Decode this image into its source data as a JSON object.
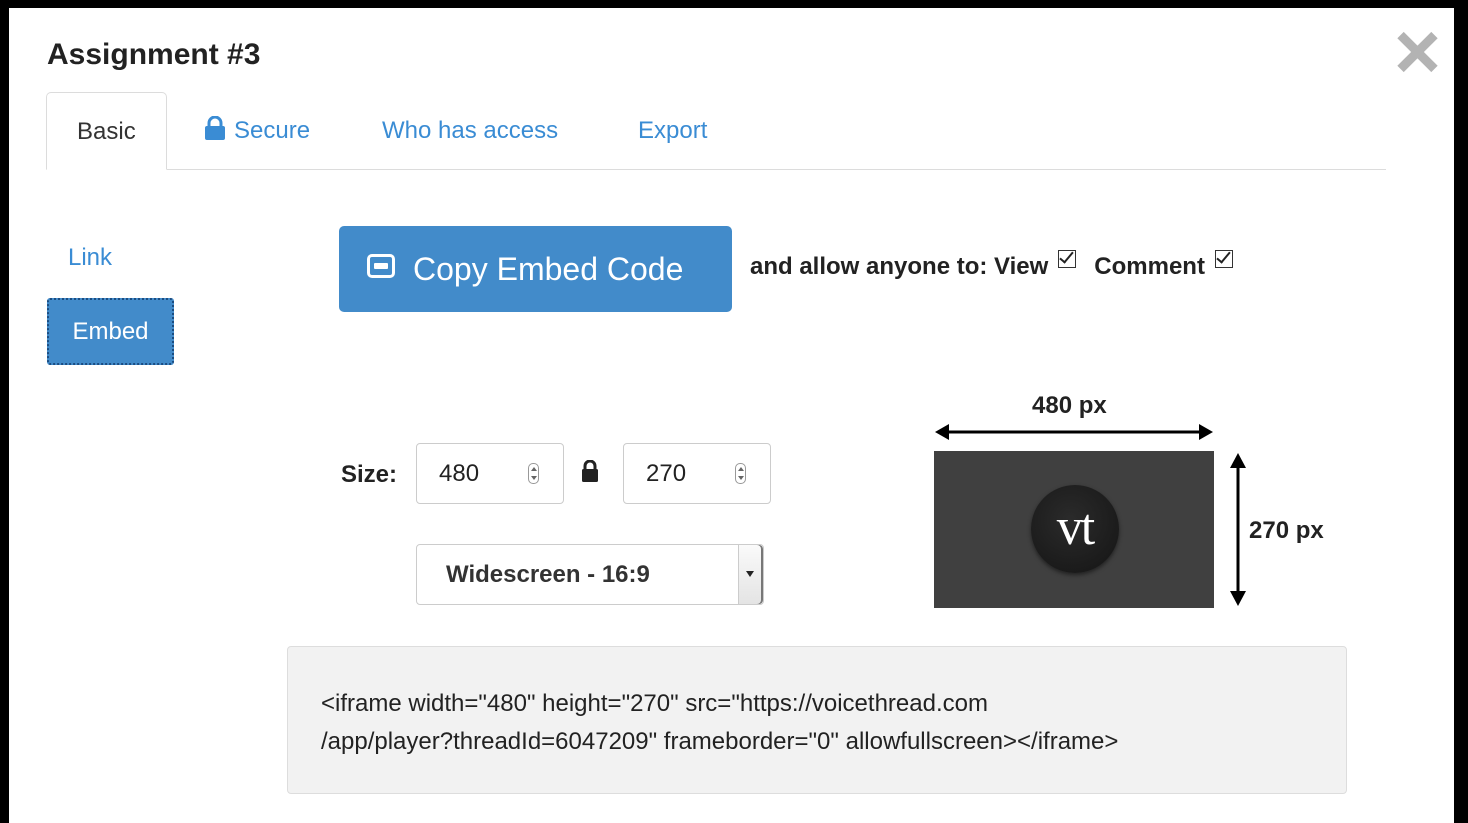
{
  "dialog": {
    "title": "Assignment #3"
  },
  "tabs": [
    {
      "label": "Basic",
      "active": true
    },
    {
      "label": "Secure",
      "icon": "lock-icon"
    },
    {
      "label": "Who has access"
    },
    {
      "label": "Export"
    }
  ],
  "sidenav": {
    "items": [
      {
        "label": "Link"
      },
      {
        "label": "Embed",
        "active": true
      }
    ]
  },
  "embed": {
    "copy_button": "Copy Embed Code",
    "allow_prefix": "and allow anyone to: View",
    "view_checked": true,
    "comment_label": "Comment",
    "comment_checked": true
  },
  "size": {
    "label": "Size:",
    "width": "480",
    "height": "270",
    "aspect_option": "Widescreen - 16:9"
  },
  "preview": {
    "width_label": "480 px",
    "height_label": "270 px",
    "logo_text": "vt"
  },
  "code": {
    "line1": "<iframe width=\"480\" height=\"270\" src=\"https://voicethread.com",
    "line2": "/app/player?threadId=6047209\" frameborder=\"0\" allowfullscreen></iframe>"
  },
  "colors": {
    "accent": "#428bca",
    "link": "#3a8cd4",
    "preview_bg": "#404040"
  }
}
